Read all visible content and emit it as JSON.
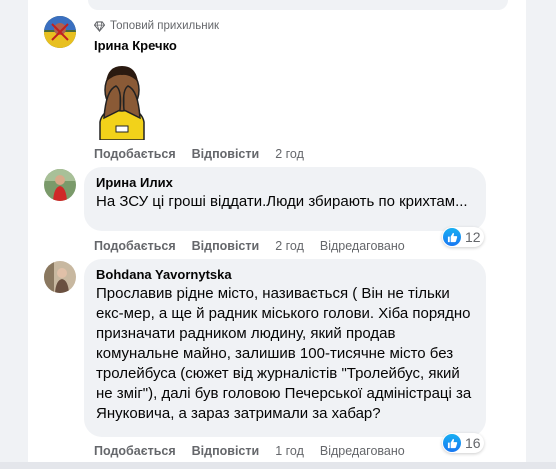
{
  "comments": [
    {
      "badge": "Топовий прихильник",
      "author": "Ірина Кречко",
      "actions": {
        "like": "Подобається",
        "reply": "Відповісти"
      },
      "time": "2 год"
    },
    {
      "author": "Ирина Илих",
      "text": "На ЗСУ ці гроші віддати.Люди збирають по крихтам...",
      "actions": {
        "like": "Подобається",
        "reply": "Відповісти"
      },
      "time": "2 год",
      "edited": "Відредаговано",
      "reactions": "12"
    },
    {
      "author": "Bohdana Yavornytska",
      "text": "Прославив рідне місто, називається ( Він не тільки екс-мер, а ще й радник міського голови. Хіба порядно призначати радником людину, який продав комунальне майно, залишив 100-тисячне місто без тролейбуса (сюжет від журналістів \"Тролейбус, який не зміг\"), далі був головою Печерської адміністраці за Януковича, а зараз затримали за хабар?",
      "actions": {
        "like": "Подобається",
        "reply": "Відповісти"
      },
      "time": "1 год",
      "edited": "Відредаговано",
      "reactions": "16"
    }
  ],
  "colors": {
    "like_blue": "#1877f2",
    "bubble": "#f0f2f5",
    "secondary_text": "#65676b"
  },
  "icons": {
    "badge": "diamond-badge-icon",
    "reaction": "thumbs-up-icon",
    "sticker": "face-palm-sticker"
  }
}
